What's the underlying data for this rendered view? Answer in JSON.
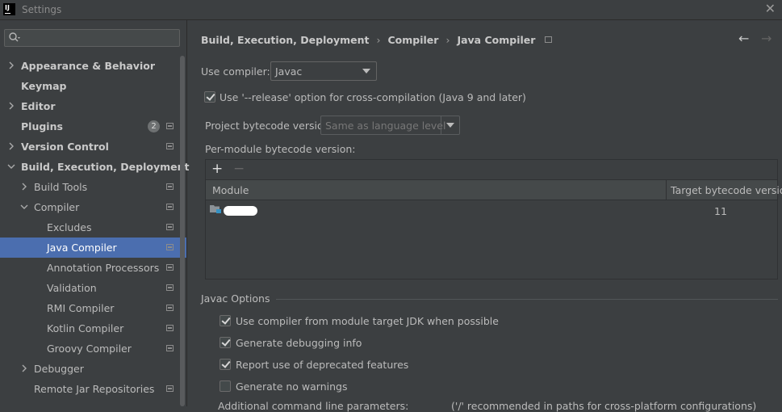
{
  "window": {
    "title": "Settings",
    "app_icon_label": "IJ"
  },
  "search": {
    "placeholder": ""
  },
  "sidebar": {
    "items": [
      {
        "label": "Appearance & Behavior",
        "bold": true
      },
      {
        "label": "Keymap",
        "bold": true
      },
      {
        "label": "Editor",
        "bold": true
      },
      {
        "label": "Plugins",
        "bold": true,
        "badge": "2"
      },
      {
        "label": "Version Control",
        "bold": true
      },
      {
        "label": "Build, Execution, Deployment",
        "bold": true
      },
      {
        "label": "Build Tools"
      },
      {
        "label": "Compiler"
      },
      {
        "label": "Excludes"
      },
      {
        "label": "Java Compiler",
        "selected": true
      },
      {
        "label": "Annotation Processors"
      },
      {
        "label": "Validation"
      },
      {
        "label": "RMI Compiler"
      },
      {
        "label": "Kotlin Compiler"
      },
      {
        "label": "Groovy Compiler"
      },
      {
        "label": "Debugger"
      },
      {
        "label": "Remote Jar Repositories"
      }
    ]
  },
  "breadcrumb": {
    "items": [
      "Build, Execution, Deployment",
      "Compiler",
      "Java Compiler"
    ],
    "separator": "›"
  },
  "nav": {
    "back": "←",
    "forward": "→"
  },
  "compiler": {
    "use_compiler_label": "Use compiler:",
    "use_compiler_value": "Javac",
    "release_option_label": "Use '--release' option for cross-compilation (Java 9 and later)",
    "release_option_checked": true,
    "project_bytecode_label": "Project bytecode version:",
    "project_bytecode_value": "Same as language level",
    "per_module_label": "Per-module bytecode version:"
  },
  "module_table": {
    "add": "+",
    "remove": "−",
    "columns": [
      "Module",
      "Target bytecode version"
    ],
    "rows": [
      {
        "module": "",
        "target": "11"
      }
    ]
  },
  "javac_options": {
    "title": "Javac Options",
    "checkboxes": [
      {
        "label": "Use compiler from module target JDK when possible",
        "checked": true
      },
      {
        "label": "Generate debugging info",
        "checked": true
      },
      {
        "label": "Report use of deprecated features",
        "checked": true
      },
      {
        "label": "Generate no warnings",
        "checked": false
      }
    ],
    "additional_params_label": "Additional command line parameters:",
    "additional_params_hint": "('/' recommended in paths for cross-platform configurations)"
  },
  "colors": {
    "background": "#3c3f41",
    "selection": "#4b6eaf",
    "text": "#bbbbbb"
  }
}
